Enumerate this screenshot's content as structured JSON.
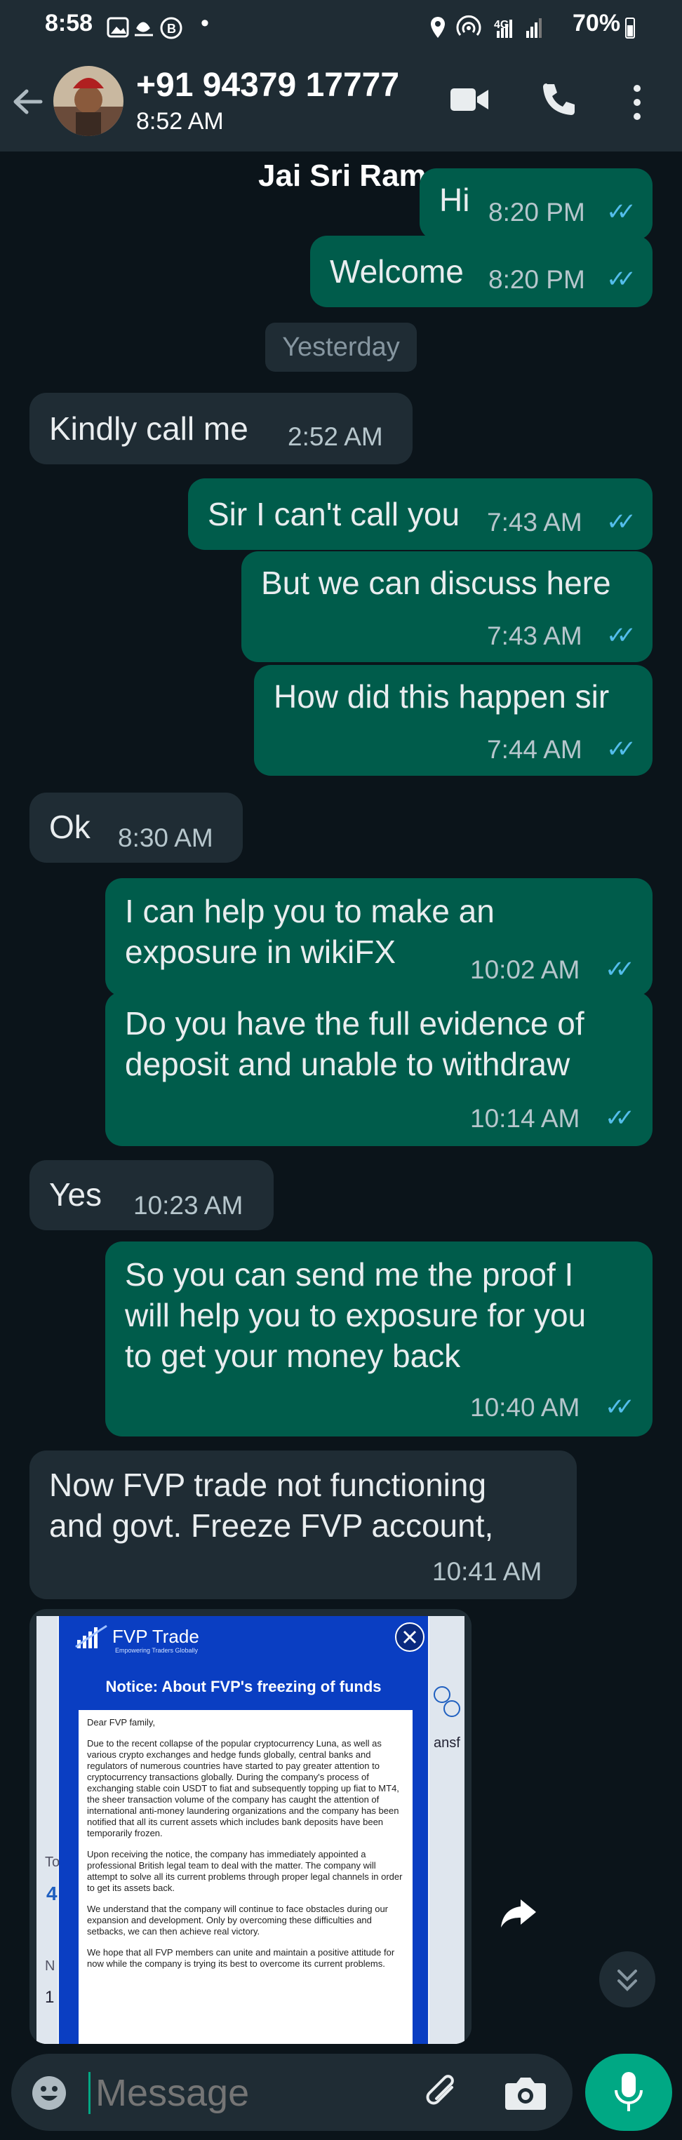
{
  "status_bar": {
    "time": "8:58",
    "network": "4G",
    "battery": "70%"
  },
  "header": {
    "contact_number": "+91 94379 17777",
    "last_seen": "8:52 AM",
    "top_name": "Jai Sri Ram"
  },
  "messages": [
    {
      "dir": "out",
      "text": "Hi",
      "time": "8:20 PM"
    },
    {
      "dir": "out",
      "text": "Welcome",
      "time": "8:20 PM"
    },
    {
      "dir": "day",
      "text": "Yesterday"
    },
    {
      "dir": "in",
      "text": "Kindly call me",
      "time": "2:52 AM"
    },
    {
      "dir": "out",
      "text": "Sir I can't call you",
      "time": "7:43 AM"
    },
    {
      "dir": "out",
      "text": "But we can discuss here",
      "time": "7:43 AM"
    },
    {
      "dir": "out",
      "text": "How did this happen sir",
      "time": "7:44 AM"
    },
    {
      "dir": "in",
      "text": "Ok",
      "time": "8:30 AM"
    },
    {
      "dir": "out",
      "text": "I can help you to make an\nexposure in wikiFX",
      "time": "10:02 AM"
    },
    {
      "dir": "out",
      "text": "Do you have the full evidence of\ndeposit and unable to withdraw",
      "time": "10:14 AM"
    },
    {
      "dir": "in",
      "text": "Yes",
      "time": "10:23 AM"
    },
    {
      "dir": "out",
      "text": "So you can send me the proof I\nwill help you to exposure for you\nto get your money back",
      "time": "10:40 AM"
    },
    {
      "dir": "in",
      "text": "Now FVP trade not functioning\nand govt. Freeze FVP account,",
      "time": "10:41 AM"
    }
  ],
  "image_message": {
    "brand": "FVP Trade",
    "tagline": "Empowering Traders Globally",
    "notice_title": "Notice: About FVP's freezing of funds",
    "greeting": "Dear FVP family,",
    "paragraphs": [
      "Due to the recent collapse of the popular cryptocurrency Luna, as well as various crypto exchanges and hedge funds globally, central banks and regulators of numerous countries have started to pay greater attention to cryptocurrency transactions globally. During the company's process of exchanging stable coin USDT to fiat and subsequently topping up fiat to MT4, the sheer transaction volume of the company has caught the attention of international anti-money laundering organizations and the company has been notified that all its current assets which includes bank deposits have been temporarily frozen.",
      "Upon receiving the notice, the company has immediately appointed a professional British legal team to deal with the matter. The company will attempt to solve all its current problems through proper legal channels in order to get its assets back.",
      "We understand that the company will continue to face obstacles during our expansion and development. Only by overcoming these difficulties and setbacks, we can then achieve real victory.",
      "We hope that all FVP members can unite and maintain a positive attitude for now while the company is trying its best to overcome its current problems."
    ],
    "side_fragments": [
      "ansf",
      "To",
      "4",
      "N",
      "1"
    ]
  },
  "input": {
    "placeholder": "Message"
  },
  "colors": {
    "outgoing_bubble": "#005c4b",
    "incoming_bubble": "#1f2c34",
    "read_ticks": "#53bdeb",
    "mic_button": "#00a884"
  }
}
